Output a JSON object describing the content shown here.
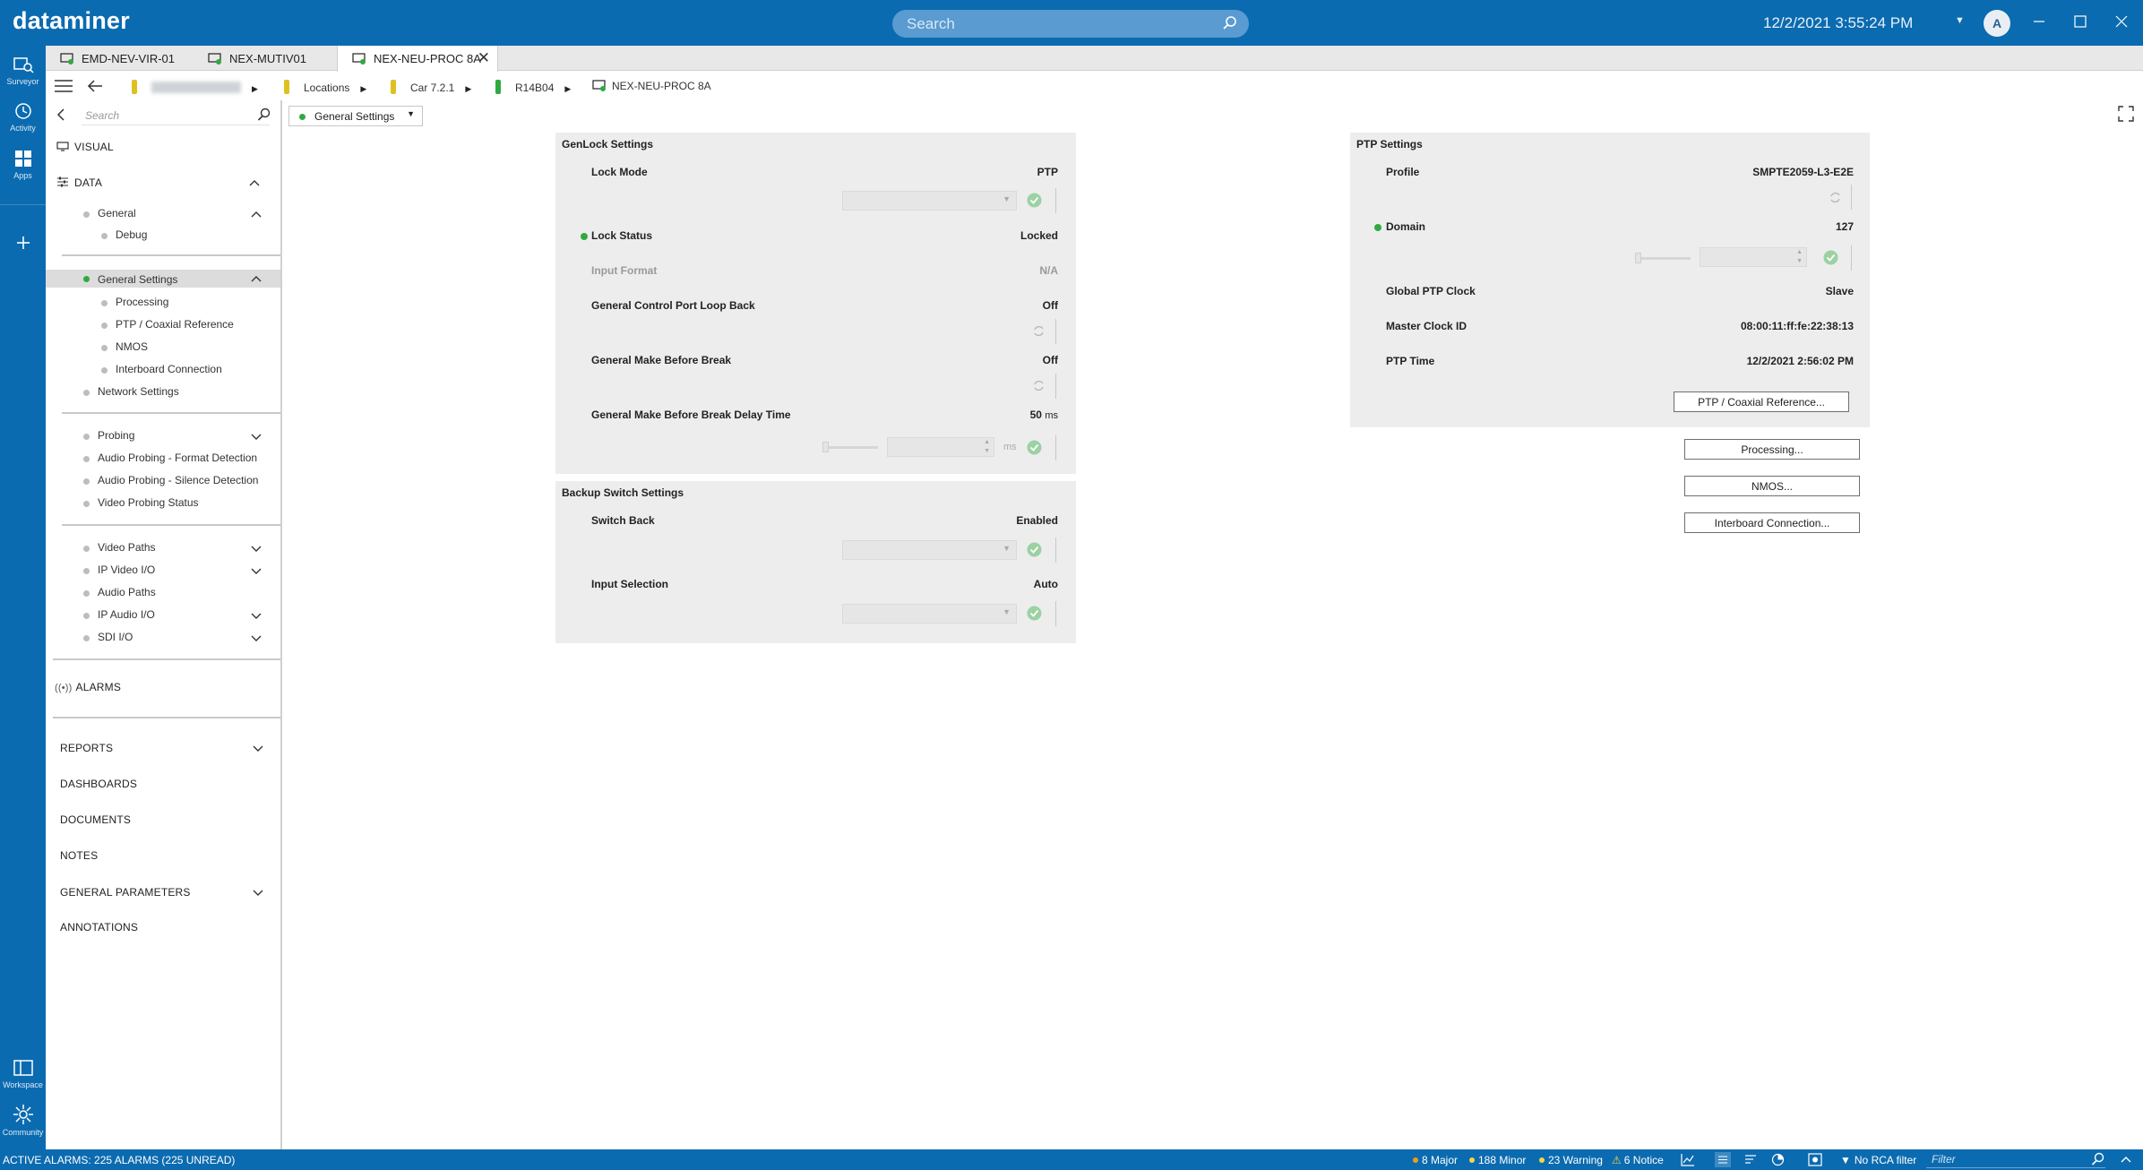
{
  "app": {
    "brand": "dataminer",
    "search_placeholder": "Search",
    "datetime": "12/2/2021 3:55:24 PM",
    "user_initial": "A"
  },
  "rail": {
    "surveyor": "Surveyor",
    "activity": "Activity",
    "apps": "Apps",
    "workspace": "Workspace",
    "community": "Community"
  },
  "tabs": [
    {
      "label": "EMD-NEV-VIR-01"
    },
    {
      "label": "NEX-MUTIV01"
    },
    {
      "label": "NEX-NEU-PROC 8A"
    }
  ],
  "breadcrumb": {
    "locations": "Locations",
    "car": "Car 7.2.1",
    "rack": "R14B04",
    "element": "NEX-NEU-PROC 8A",
    "colors": {
      "yellow": "#e0c020",
      "green": "#2faa3f"
    }
  },
  "side": {
    "search_placeholder": "Search",
    "visual": "VISUAL",
    "data": "DATA",
    "general": "General",
    "debug": "Debug",
    "general_settings": "General Settings",
    "processing": "Processing",
    "ptp_coax": "PTP / Coaxial Reference",
    "nmos": "NMOS",
    "interboard": "Interboard Connection",
    "network_settings": "Network Settings",
    "probing": "Probing",
    "audio_format": "Audio Probing - Format Detection",
    "audio_silence": "Audio Probing - Silence Detection",
    "video_probing": "Video Probing Status",
    "video_paths": "Video Paths",
    "ip_video": "IP Video I/O",
    "audio_paths": "Audio Paths",
    "ip_audio": "IP Audio I/O",
    "sdi": "SDI I/O",
    "alarms": "ALARMS",
    "reports": "REPORTS",
    "dashboards": "DASHBOARDS",
    "documents": "DOCUMENTS",
    "notes": "NOTES",
    "general_parameters": "GENERAL PARAMETERS",
    "annotations": "ANNOTATIONS"
  },
  "page_selector": "General Settings",
  "genlock": {
    "title": "GenLock Settings",
    "lock_mode_label": "Lock Mode",
    "lock_mode_value": "PTP",
    "lock_status_label": "Lock Status",
    "lock_status_value": "Locked",
    "input_format_label": "Input Format",
    "input_format_value": "N/A",
    "loop_back_label": "General Control Port Loop Back",
    "loop_back_value": "Off",
    "mbb_label": "General Make Before Break",
    "mbb_value": "Off",
    "mbb_delay_label": "General Make Before Break Delay Time",
    "mbb_delay_value": "50",
    "mbb_delay_unit": "ms",
    "mbb_delay_input_unit": "ms"
  },
  "backup": {
    "title": "Backup Switch Settings",
    "switch_back_label": "Switch Back",
    "switch_back_value": "Enabled",
    "input_selection_label": "Input Selection",
    "input_selection_value": "Auto"
  },
  "ptp": {
    "title": "PTP Settings",
    "profile_label": "Profile",
    "profile_value": "SMPTE2059-L3-E2E",
    "domain_label": "Domain",
    "domain_value": "127",
    "global_clock_label": "Global PTP Clock",
    "global_clock_value": "Slave",
    "master_id_label": "Master Clock ID",
    "master_id_value": "08:00:11:ff:fe:22:38:13",
    "ptp_time_label": "PTP Time",
    "ptp_time_value": "12/2/2021 2:56:02 PM"
  },
  "buttons": {
    "ptp_ref": "PTP / Coaxial Reference...",
    "processing": "Processing...",
    "nmos": "NMOS...",
    "interboard": "Interboard Connection..."
  },
  "statusbar": {
    "active_alarms": "ACTIVE ALARMS: 225 ALARMS (225 UNREAD)",
    "major": "8 Major",
    "minor": "188 Minor",
    "warning": "23 Warning",
    "notice": "6 Notice",
    "rca": "No RCA filter",
    "filter_placeholder": "Filter",
    "colors": {
      "major": "#f39c12",
      "minor": "#f5d742",
      "warning": "#f5d742",
      "notice": "#f5d742"
    }
  }
}
